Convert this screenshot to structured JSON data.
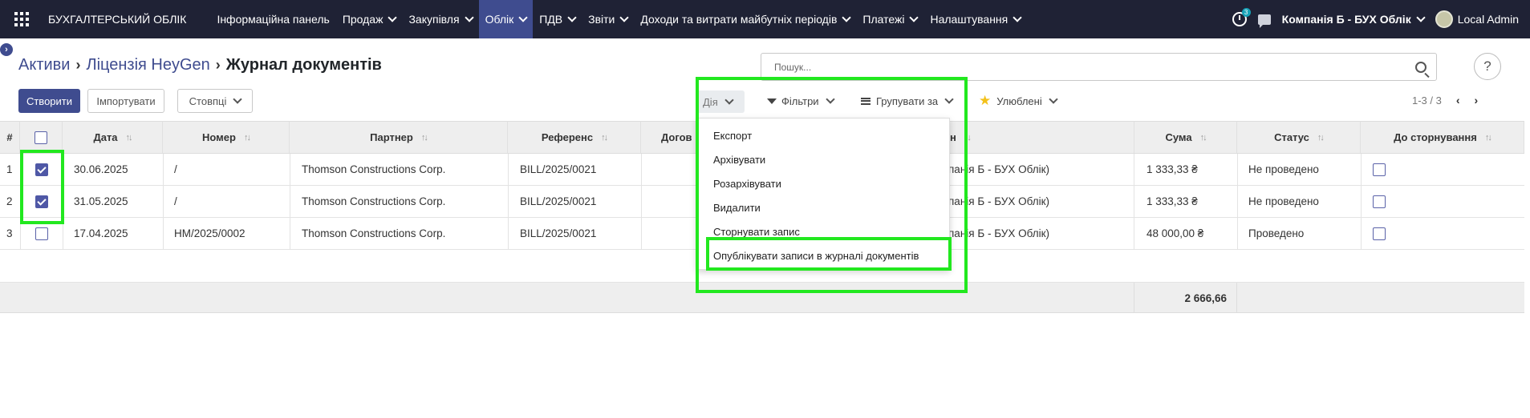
{
  "navbar": {
    "brand": "БУХГАЛТЕРСЬКИЙ ОБЛІК",
    "menu": [
      {
        "label": "Інформаційна панель",
        "has_caret": false,
        "active": false
      },
      {
        "label": "Продаж",
        "has_caret": true,
        "active": false
      },
      {
        "label": "Закупівля",
        "has_caret": true,
        "active": false
      },
      {
        "label": "Облік",
        "has_caret": true,
        "active": true
      },
      {
        "label": "ПДВ",
        "has_caret": true,
        "active": false
      },
      {
        "label": "Звіти",
        "has_caret": true,
        "active": false
      },
      {
        "label": "Доходи та витрати майбутніх періодів",
        "has_caret": true,
        "active": false
      },
      {
        "label": "Платежі",
        "has_caret": true,
        "active": false
      },
      {
        "label": "Налаштування",
        "has_caret": true,
        "active": false
      }
    ],
    "activity_badge": "3",
    "company": "Компанія Б - БУХ Облік",
    "user": "Local Admin"
  },
  "breadcrumb": {
    "items": [
      "Активи",
      "Ліцензія HeyGen"
    ],
    "current": "Журнал документів"
  },
  "toolbar": {
    "create_label": "Створити",
    "import_label": "Імпортувати",
    "columns_label": "Стовпці"
  },
  "search": {
    "placeholder": "Пошук...",
    "help_label": "?"
  },
  "filters": {
    "action_label": "Дія",
    "filters_label": "Фільтри",
    "groupby_label": "Групувати за",
    "favorites_label": "Улюблені"
  },
  "pager": {
    "range": "1-3 / 3",
    "prev": "‹",
    "next": "›"
  },
  "table": {
    "headers": {
      "num": "#",
      "date": "Дата",
      "number": "Номер",
      "partner": "Партнер",
      "reference": "Референс",
      "contract": "Догов",
      "company": "н",
      "amount": "Сума",
      "status": "Статус",
      "reverse": "До сторнування"
    },
    "rows": [
      {
        "num": "1",
        "checked": true,
        "date": "30.06.2025",
        "number": "/",
        "partner": "Thomson Constructions Corp.",
        "reference": "BILL/2025/0021",
        "company": "панія Б - БУХ Облік)",
        "amount": "1 333,33 ₴",
        "status": "Не проведено",
        "reverse": false
      },
      {
        "num": "2",
        "checked": true,
        "date": "31.05.2025",
        "number": "/",
        "partner": "Thomson Constructions Corp.",
        "reference": "BILL/2025/0021",
        "company": "панія Б - БУХ Облік)",
        "amount": "1 333,33 ₴",
        "status": "Не проведено",
        "reverse": false
      },
      {
        "num": "3",
        "checked": false,
        "date": "17.04.2025",
        "number": "HM/2025/0002",
        "partner": "Thomson Constructions Corp.",
        "reference": "BILL/2025/0021",
        "company": "панія Б - БУХ Облік)",
        "amount": "48 000,00 ₴",
        "status": "Проведено",
        "reverse": false
      }
    ],
    "total_amount": "2 666,66"
  },
  "action_menu": {
    "items": [
      "Експорт",
      "Архівувати",
      "Розархівувати",
      "Видалити",
      "Сторнувати запис",
      "Опублікувати записи в журналі документів"
    ]
  },
  "highlight_color": "#22e81f",
  "accent_color": "#3f4c8f"
}
